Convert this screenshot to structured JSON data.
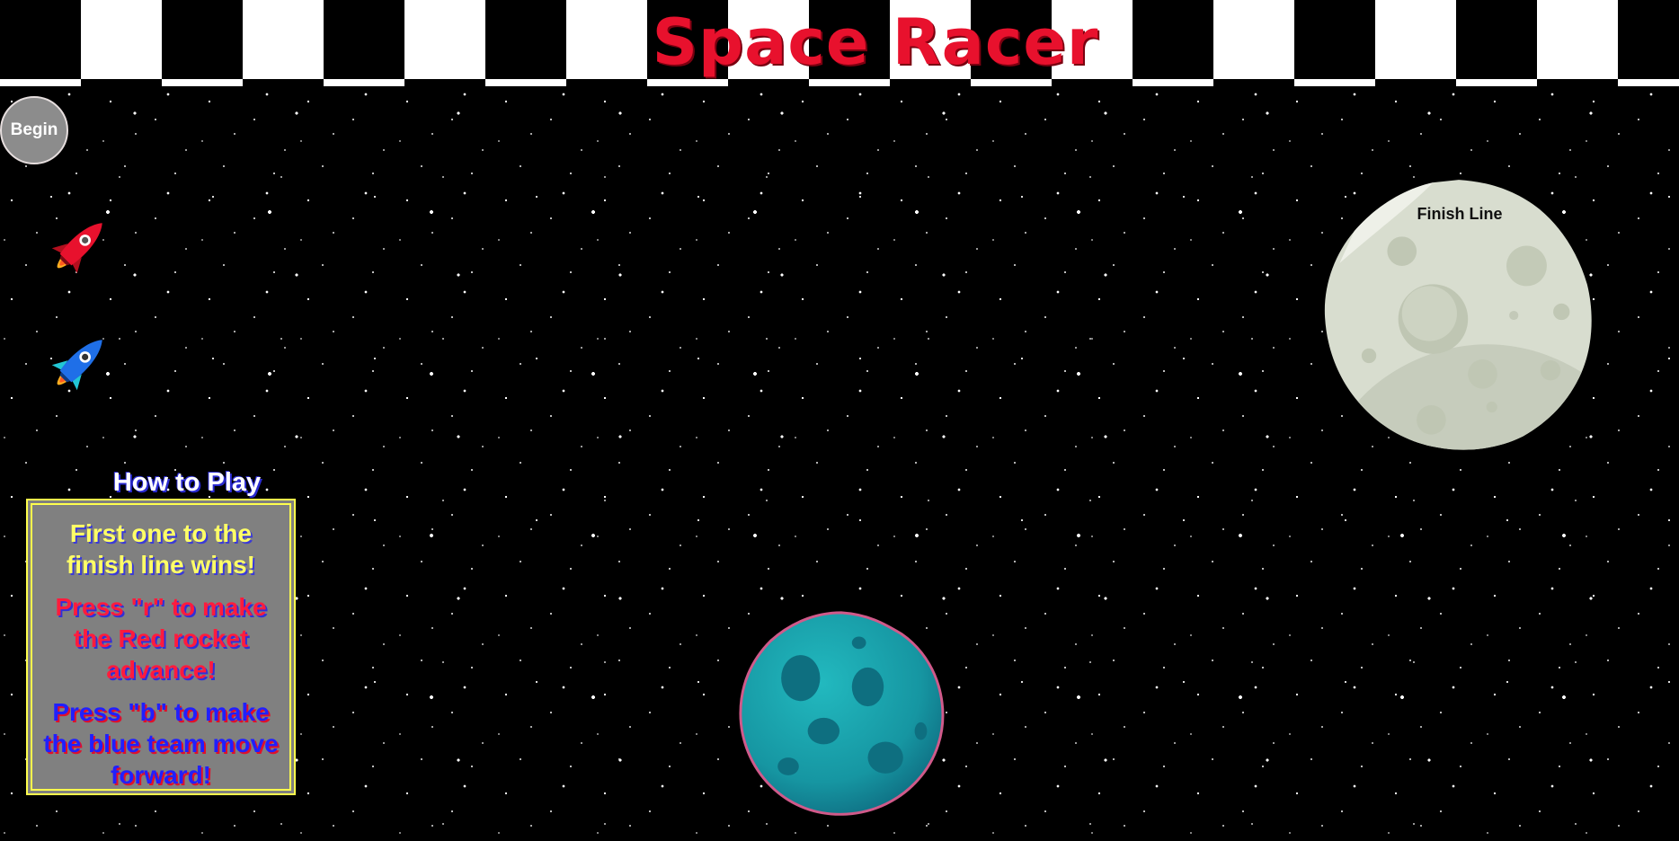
{
  "game": {
    "title": "Space Racer",
    "begin_label": "Begin",
    "finish_label": "Finish Line"
  },
  "instructions": {
    "heading": "How to Play",
    "lines": [
      "First one to the finish line wins!",
      "Press \"r\" to make the Red rocket advance!",
      "Press \"b\" to make the blue team move forward!"
    ]
  },
  "colors": {
    "title": "#e8112d",
    "red_rocket": "#e8112d",
    "blue_rocket": "#1f6fe8",
    "moon": "#d6dccd",
    "planet": "#17a0a8",
    "instruction_box_border": "#ffff4d"
  },
  "icons": {
    "red_rocket": "rocket-icon",
    "blue_rocket": "rocket-icon",
    "finish": "moon",
    "obstacle": "planet"
  }
}
